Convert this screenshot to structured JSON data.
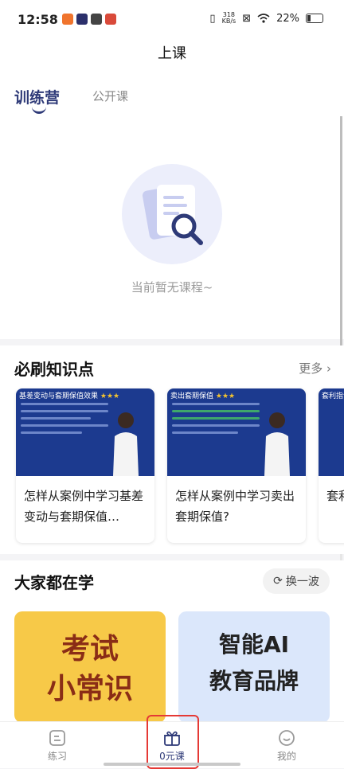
{
  "status_bar": {
    "time": "12:58",
    "net_speed_top": "318",
    "net_speed_bottom": "KB/s",
    "battery": "22%"
  },
  "header": {
    "title": "上课"
  },
  "tabs": [
    {
      "label": "训练营",
      "active": true
    },
    {
      "label": "公开课",
      "active": false
    }
  ],
  "empty_state": {
    "icon": "document-search-icon",
    "text": "当前暂无课程~"
  },
  "knowledge": {
    "title": "必刷知识点",
    "more": "更多",
    "cards": [
      {
        "thumb_title": "基差变动与套期保值效果",
        "stars": "★★★",
        "text": "怎样从案例中学习基差变动与套期保值…"
      },
      {
        "thumb_title": "卖出套期保值",
        "stars": "★★★",
        "text": "怎样从案例中学习卖出套期保值?"
      },
      {
        "thumb_title": "套利指令",
        "stars": "",
        "text": "套利分?"
      }
    ]
  },
  "learning": {
    "title": "大家都在学",
    "refresh": "换一波",
    "promos": [
      {
        "line1": "考试",
        "line2": "小常识",
        "bg": "#f7c948"
      },
      {
        "line1": "智能AI",
        "line2": "教育品牌",
        "bg": "#dbe7fb"
      }
    ]
  },
  "nav": [
    {
      "label": "练习",
      "icon": "practice-icon",
      "active": false
    },
    {
      "label": "0元课",
      "icon": "gift-icon",
      "active": true
    },
    {
      "label": "我的",
      "icon": "smile-icon",
      "active": false
    }
  ],
  "colors": {
    "accent": "#2e3a78",
    "highlight": "#e53935",
    "thumb_bg": "#1c3a8f"
  }
}
